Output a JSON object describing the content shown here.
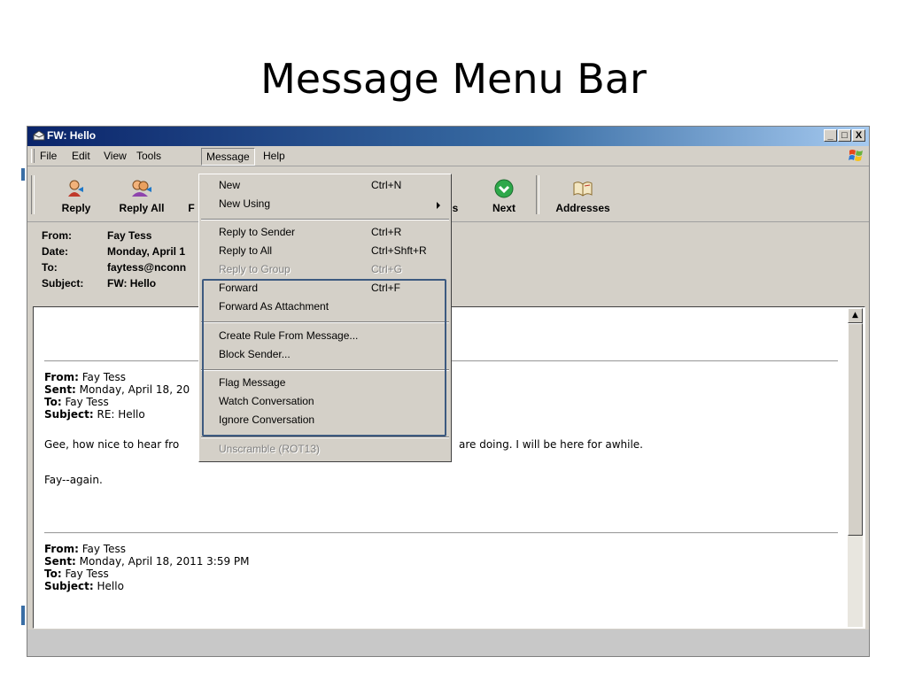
{
  "slide": {
    "title": "Message Menu Bar"
  },
  "window": {
    "title": "FW: Hello",
    "controls": {
      "minimize": "_",
      "maximize": "□",
      "close": "X"
    }
  },
  "menubar": {
    "items": [
      "File",
      "Edit",
      "View",
      "Tools",
      "Message",
      "Help"
    ],
    "active": "Message"
  },
  "toolbar": {
    "buttons": [
      {
        "label": "Reply",
        "icon": "reply-icon"
      },
      {
        "label": "Reply All",
        "icon": "reply-all-icon"
      },
      {
        "label": "F",
        "icon": "forward-icon"
      },
      {
        "label": "s",
        "icon": "previous-icon"
      },
      {
        "label": "Next",
        "icon": "next-arrow-icon"
      },
      {
        "label": "Addresses",
        "icon": "address-book-icon"
      }
    ]
  },
  "headers": {
    "from": {
      "label": "From:",
      "value": "Fay Tess"
    },
    "date": {
      "label": "Date:",
      "value": "Monday, April 1"
    },
    "to": {
      "label": "To:",
      "value": "faytess@nconn"
    },
    "subject": {
      "label": "Subject:",
      "value": "FW: Hello"
    }
  },
  "message": {
    "block1": {
      "from_label": "From:",
      "from_value": " Fay Tess",
      "sent_label": "Sent:",
      "sent_value": " Monday, April 18, 20",
      "to_label": "To:",
      "to_value": " Fay Tess",
      "subject_label": "Subject:",
      "subject_value": " RE: Hello"
    },
    "body_line_left": "Gee, how nice to hear fro",
    "body_line_right": "are doing.  I will be here for awhile.",
    "signature": "Fay--again.",
    "block2": {
      "from_label": "From:",
      "from_value": " Fay Tess",
      "sent_label": "Sent:",
      "sent_value": " Monday, April 18, 2011 3:59 PM",
      "to_label": "To:",
      "to_value": " Fay Tess",
      "subject_label": "Subject:",
      "subject_value": " Hello"
    }
  },
  "dropdown": {
    "items": [
      {
        "label": "New",
        "shortcut": "Ctrl+N",
        "disabled": false
      },
      {
        "label": "New Using",
        "shortcut": "",
        "disabled": false,
        "submenu": true
      },
      {
        "label": "Reply to Sender",
        "shortcut": "Ctrl+R",
        "disabled": false
      },
      {
        "label": "Reply to All",
        "shortcut": "Ctrl+Shft+R",
        "disabled": false
      },
      {
        "label": "Reply to Group",
        "shortcut": "Ctrl+G",
        "disabled": true
      },
      {
        "label": "Forward",
        "shortcut": "Ctrl+F",
        "disabled": false
      },
      {
        "label": "Forward As Attachment",
        "shortcut": "",
        "disabled": false
      },
      {
        "label": "Create Rule From Message...",
        "shortcut": "",
        "disabled": false
      },
      {
        "label": "Block Sender...",
        "shortcut": "",
        "disabled": false
      },
      {
        "label": "Flag Message",
        "shortcut": "",
        "disabled": false
      },
      {
        "label": "Watch Conversation",
        "shortcut": "",
        "disabled": false
      },
      {
        "label": "Ignore Conversation",
        "shortcut": "",
        "disabled": false
      },
      {
        "label": "Unscramble (ROT13)",
        "shortcut": "",
        "disabled": true
      }
    ]
  },
  "colors": {
    "titlebar": "#0a246a",
    "highlight_box": "#3d5a80",
    "chrome": "#d4d0c8"
  }
}
